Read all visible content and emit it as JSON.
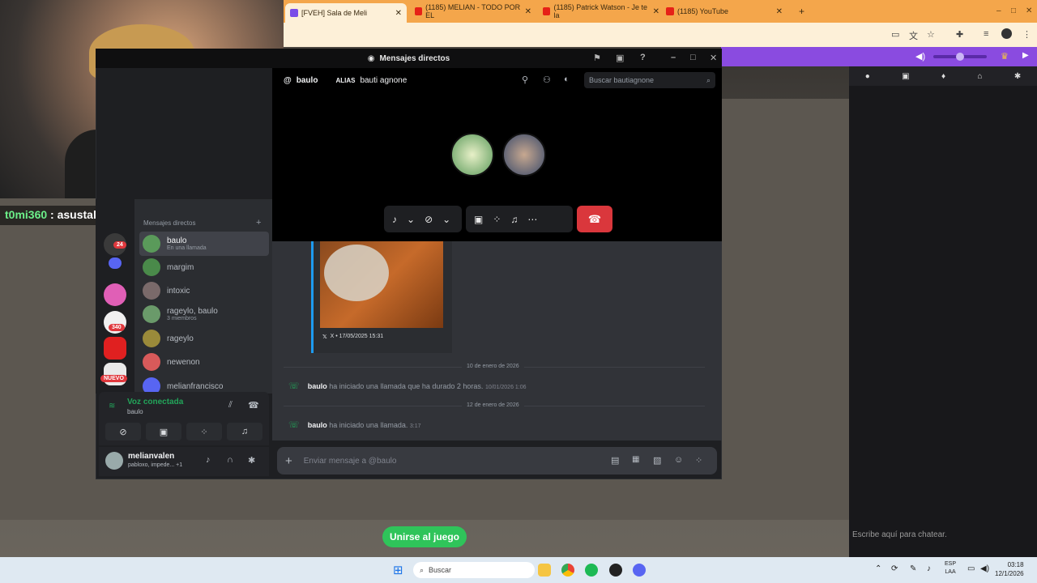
{
  "browser": {
    "tabs": [
      {
        "title": "[FVEH] Sala de Meli",
        "favicon_color": "#7a4de8"
      },
      {
        "title": "(1185) MELIAN - TODO POR EL",
        "favicon_color": "#e62117"
      },
      {
        "title": "(1185) Patrick Watson - Je te la",
        "favicon_color": "#e62117"
      },
      {
        "title": "(1185) YouTube",
        "favicon_color": "#e62117"
      }
    ],
    "new_tab": "+"
  },
  "stream_chat": {
    "overlay_user": "t0mi360",
    "overlay_text": ": asustalo",
    "input_placeholder": "Escribe aquí para chatear."
  },
  "discord": {
    "window_title": "Mensajes directos",
    "channel_name": "baulo",
    "alias_label": "ALIAS",
    "alias_value": "bauti agnone",
    "search_placeholder": "Buscar bautiagnone",
    "dm_header": "Mensajes directos",
    "guild_badges": [
      "24",
      "340",
      "NUEVO"
    ],
    "dms": [
      {
        "name": "baulo",
        "sub": "En una llamada",
        "color": "#5a9a5a"
      },
      {
        "name": "margim",
        "sub": "",
        "color": "#4a8a4a"
      },
      {
        "name": "intoxic",
        "sub": "",
        "color": "#7a6a6a"
      },
      {
        "name": "rageylo, baulo",
        "sub": "3 miembros",
        "color": "#6a9a6a"
      },
      {
        "name": "rageylo",
        "sub": "",
        "color": "#9a8a3a"
      },
      {
        "name": "newenon",
        "sub": "",
        "color": "#d85a5a"
      },
      {
        "name": "melianfrancisco",
        "sub": "",
        "color": "#5865f2"
      }
    ],
    "voice_status": "Voz conectada",
    "voice_channel": "baulo",
    "username": "melianvalen",
    "user_status": "pabloxo, impede... +1",
    "embed_source": "X • 17/05/2025 15:31",
    "messages": [
      {
        "divider": "10 de enero de 2026",
        "user": "baulo",
        "text": "ha iniciado una llamada que ha durado 2 horas.",
        "time": "10/01/2026 1:06"
      },
      {
        "divider": "12 de enero de 2026",
        "user": "baulo",
        "text": "ha iniciado una llamada.",
        "time": "3:17"
      }
    ],
    "composer_placeholder": "Enviar mensaje a @baulo"
  },
  "game": {
    "join_button": "Unirse al juego"
  },
  "taskbar": {
    "search_placeholder": "Buscar",
    "lang_top": "ESP",
    "lang_bottom": "LAA",
    "time": "03:18",
    "date": "12/1/2026"
  },
  "colors": {
    "accent_twitch": "#8a4be0",
    "discord_bg": "#313338",
    "hangup": "#da373c",
    "join_green": "#2fc45a"
  }
}
